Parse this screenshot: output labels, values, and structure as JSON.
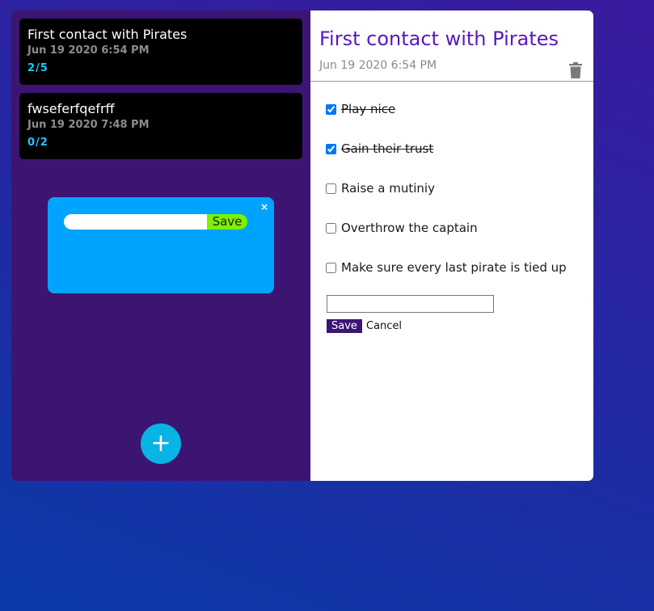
{
  "notes": [
    {
      "title": "First contact with Pirates",
      "date": "Jun 19 2020 6:54 PM",
      "count": "2/5"
    },
    {
      "title": "fwseferfqefrff",
      "date": "Jun 19 2020 7:48 PM",
      "count": "0/2"
    }
  ],
  "popup": {
    "close": "×",
    "input_value": "",
    "save_label": "Save"
  },
  "fab_label": "+",
  "detail": {
    "title": "First contact with Pirates",
    "date": "Jun 19 2020 6:54 PM",
    "tasks": [
      {
        "label": "Play nice",
        "done": true
      },
      {
        "label": "Gain their trust",
        "done": true
      },
      {
        "label": "Raise a mutiniy",
        "done": false
      },
      {
        "label": "Overthrow the captain",
        "done": false
      },
      {
        "label": "Make sure every last pirate is tied up",
        "done": false
      }
    ],
    "new_task_value": "",
    "save_label": "Save",
    "cancel_label": "Cancel"
  },
  "icons": {
    "delete": "trash-icon",
    "add": "plus-icon",
    "close": "close-icon"
  },
  "colors": {
    "sidebar_bg": "#3c1572",
    "count_accent": "#1ec8ff",
    "popup_bg": "#00a4ff",
    "popup_save": "#7ff000",
    "fab": "#07b5e4",
    "detail_title": "#5a17c0"
  }
}
